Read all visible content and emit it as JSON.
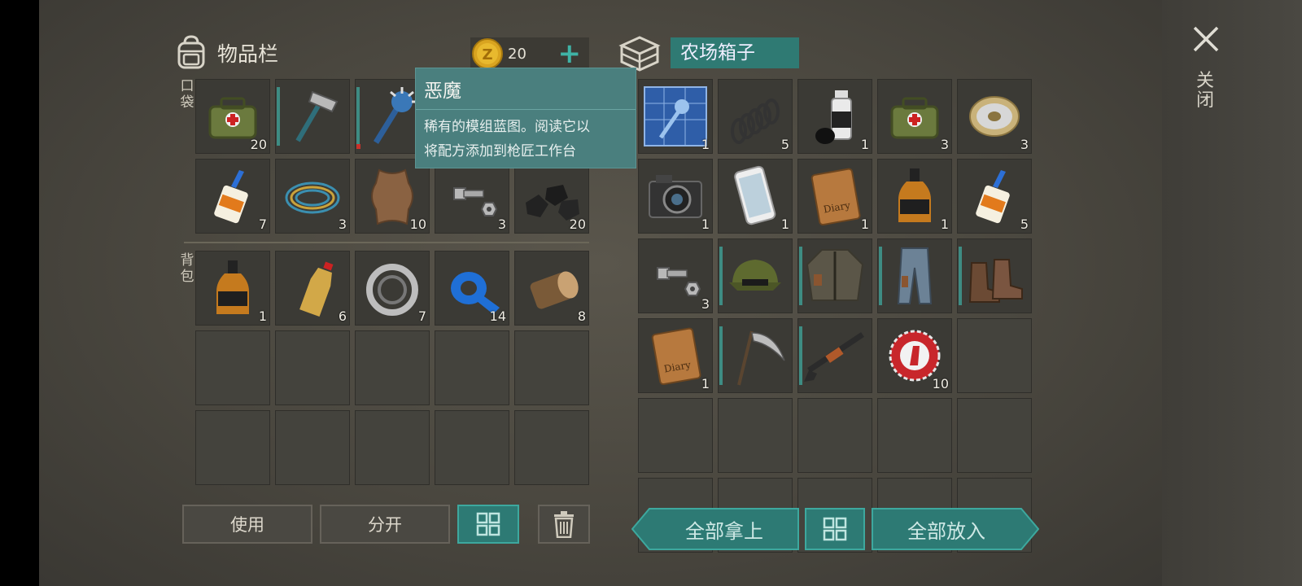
{
  "header": {
    "inventory_title": "物品栏",
    "coins": "20",
    "plus_label": "+",
    "box_title": "农场箱子"
  },
  "close": {
    "label": "关闭"
  },
  "side_labels": {
    "pocket": "口袋",
    "backpack": "背包"
  },
  "tooltip": {
    "title": "恶魔",
    "description_line1": "稀有的模组蓝图。阅读它以",
    "description_line2": "将配方添加到枪匠工作台"
  },
  "pocket_items": [
    {
      "icon": "medkit-bag-icon",
      "qty": "20"
    },
    {
      "icon": "hammer-icon",
      "qty": ""
    },
    {
      "icon": "spiked-mace-icon",
      "qty": ""
    },
    {
      "icon": "hidden-slot",
      "qty": ""
    },
    {
      "icon": "hidden-slot",
      "qty": ""
    },
    {
      "icon": "glue-bottle-icon",
      "qty": "7"
    },
    {
      "icon": "wire-coil-icon",
      "qty": "3"
    },
    {
      "icon": "animal-hide-icon",
      "qty": "10"
    },
    {
      "icon": "bolt-nut-icon",
      "qty": "3"
    },
    {
      "icon": "coal-icon",
      "qty": "20"
    }
  ],
  "backpack_items": [
    {
      "icon": "whiskey-bottle-icon",
      "qty": "1"
    },
    {
      "icon": "plastic-bottle-icon",
      "qty": "6"
    },
    {
      "icon": "bearing-icon",
      "qty": "7"
    },
    {
      "icon": "duct-tape-icon",
      "qty": "14"
    },
    {
      "icon": "log-icon",
      "qty": "8"
    }
  ],
  "box_items": [
    {
      "icon": "blueprint-icon",
      "qty": "1"
    },
    {
      "icon": "spring-icon",
      "qty": "5"
    },
    {
      "icon": "spray-paint-icon",
      "qty": "1"
    },
    {
      "icon": "medkit-bag-icon",
      "qty": "3"
    },
    {
      "icon": "wire-spool-icon",
      "qty": "3"
    },
    {
      "icon": "camera-icon",
      "qty": "1"
    },
    {
      "icon": "phone-icon",
      "qty": "1"
    },
    {
      "icon": "diary-icon",
      "qty": "1"
    },
    {
      "icon": "whiskey-bottle-icon",
      "qty": "1"
    },
    {
      "icon": "glue-bottle-icon",
      "qty": "5"
    },
    {
      "icon": "bolt-nut-icon",
      "qty": "3"
    },
    {
      "icon": "cap-icon",
      "qty": ""
    },
    {
      "icon": "jacket-icon",
      "qty": ""
    },
    {
      "icon": "pants-icon",
      "qty": ""
    },
    {
      "icon": "boots-icon",
      "qty": ""
    },
    {
      "icon": "diary-icon",
      "qty": "1"
    },
    {
      "icon": "scythe-icon",
      "qty": ""
    },
    {
      "icon": "shotgun-icon",
      "qty": ""
    },
    {
      "icon": "bottle-cap-icon",
      "qty": "10"
    }
  ],
  "buttons": {
    "use": "使用",
    "split": "分开",
    "take_all": "全部拿上",
    "put_all": "全部放入"
  },
  "colors": {
    "accent_teal": "#2d7a74",
    "tooltip_bg": "#4a7f7e",
    "durability": "#3e8c83"
  }
}
